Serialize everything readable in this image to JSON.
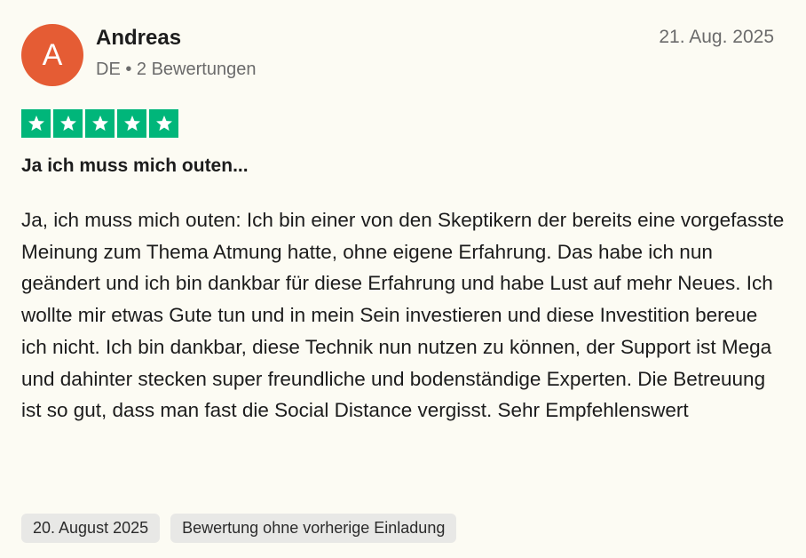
{
  "reviewer": {
    "avatar_initial": "A",
    "avatar_color": "#e55c34",
    "name": "Andreas",
    "meta": "DE • 2 Bewertungen"
  },
  "review": {
    "date": "21. Aug. 2025",
    "rating": 5,
    "rating_max": 5,
    "star_color": "#00b67a",
    "title": "Ja ich muss mich outen...",
    "body": "Ja, ich muss mich outen: Ich bin einer von den Skeptikern der bereits eine vorgefasste Meinung zum Thema Atmung hatte, ohne eigene Erfahrung. Das habe ich nun geändert und ich bin dankbar für diese Erfahrung und habe Lust auf mehr Neues. Ich wollte mir etwas Gute tun und in mein Sein investieren und diese Investition bereue ich nicht. Ich bin dankbar, diese Technik nun nutzen zu können, der Support ist Mega und dahinter stecken super freundliche und bodenständige Experten. Die Betreuung ist so gut, dass man fast die Social Distance vergisst. Sehr Empfehlenswert"
  },
  "tags": {
    "experience_date": "20. August 2025",
    "invitation_status": "Bewertung ohne vorherige Einladung"
  },
  "icons": {
    "star": "star-icon"
  }
}
